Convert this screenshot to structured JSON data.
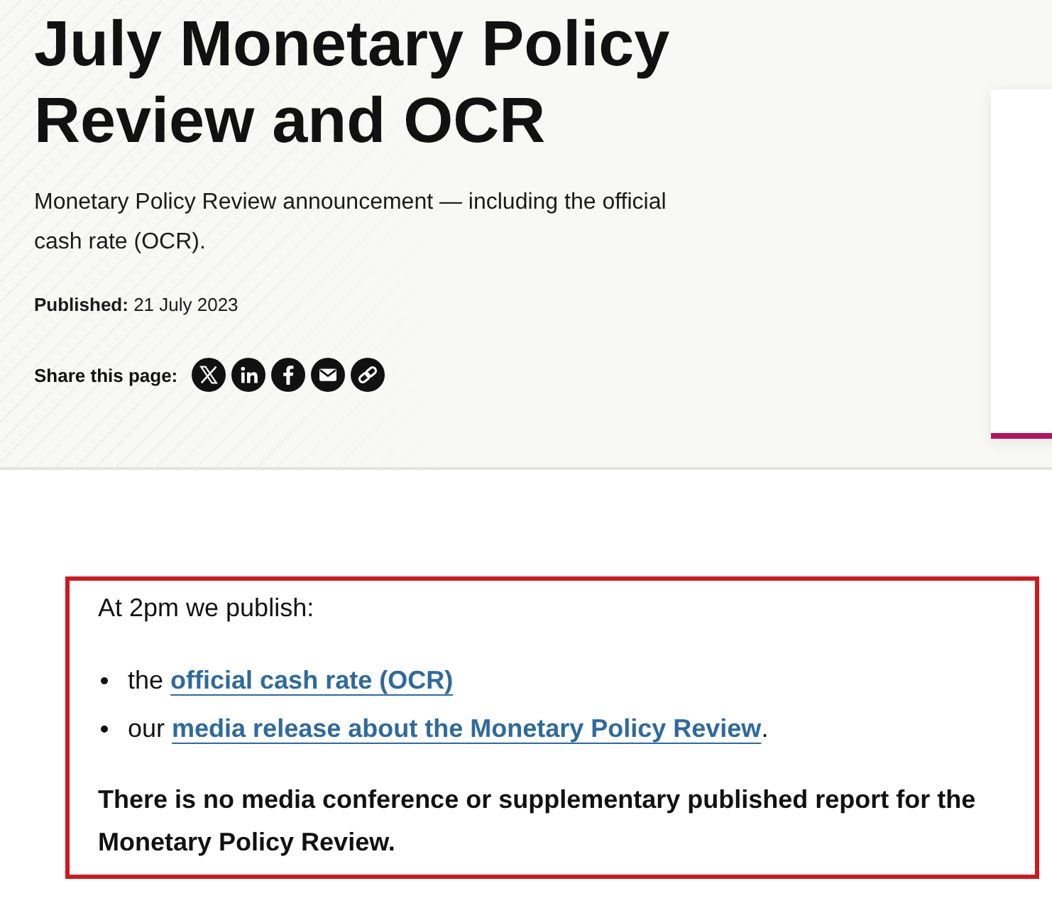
{
  "hero": {
    "title": "July Monetary Policy Review and OCR",
    "summary": "Monetary Policy Review announcement — including the official cash rate (OCR).",
    "published": {
      "label": "Published:",
      "date": "21 July 2023"
    },
    "share": {
      "label": "Share this page:",
      "buttons": [
        {
          "kind": "x"
        },
        {
          "kind": "linkedin"
        },
        {
          "kind": "facebook"
        },
        {
          "kind": "email"
        },
        {
          "kind": "link"
        }
      ]
    }
  },
  "content": {
    "highlighted": true,
    "intro": "At 2pm we publish:",
    "items": [
      {
        "prefix": "the",
        "link": "official cash rate (OCR)"
      },
      {
        "prefix": "our",
        "link": "media release about the Monetary Policy Review",
        "suffix": "."
      }
    ],
    "note": "There is no media conference or supplementary published report for the Monetary Policy Review."
  }
}
